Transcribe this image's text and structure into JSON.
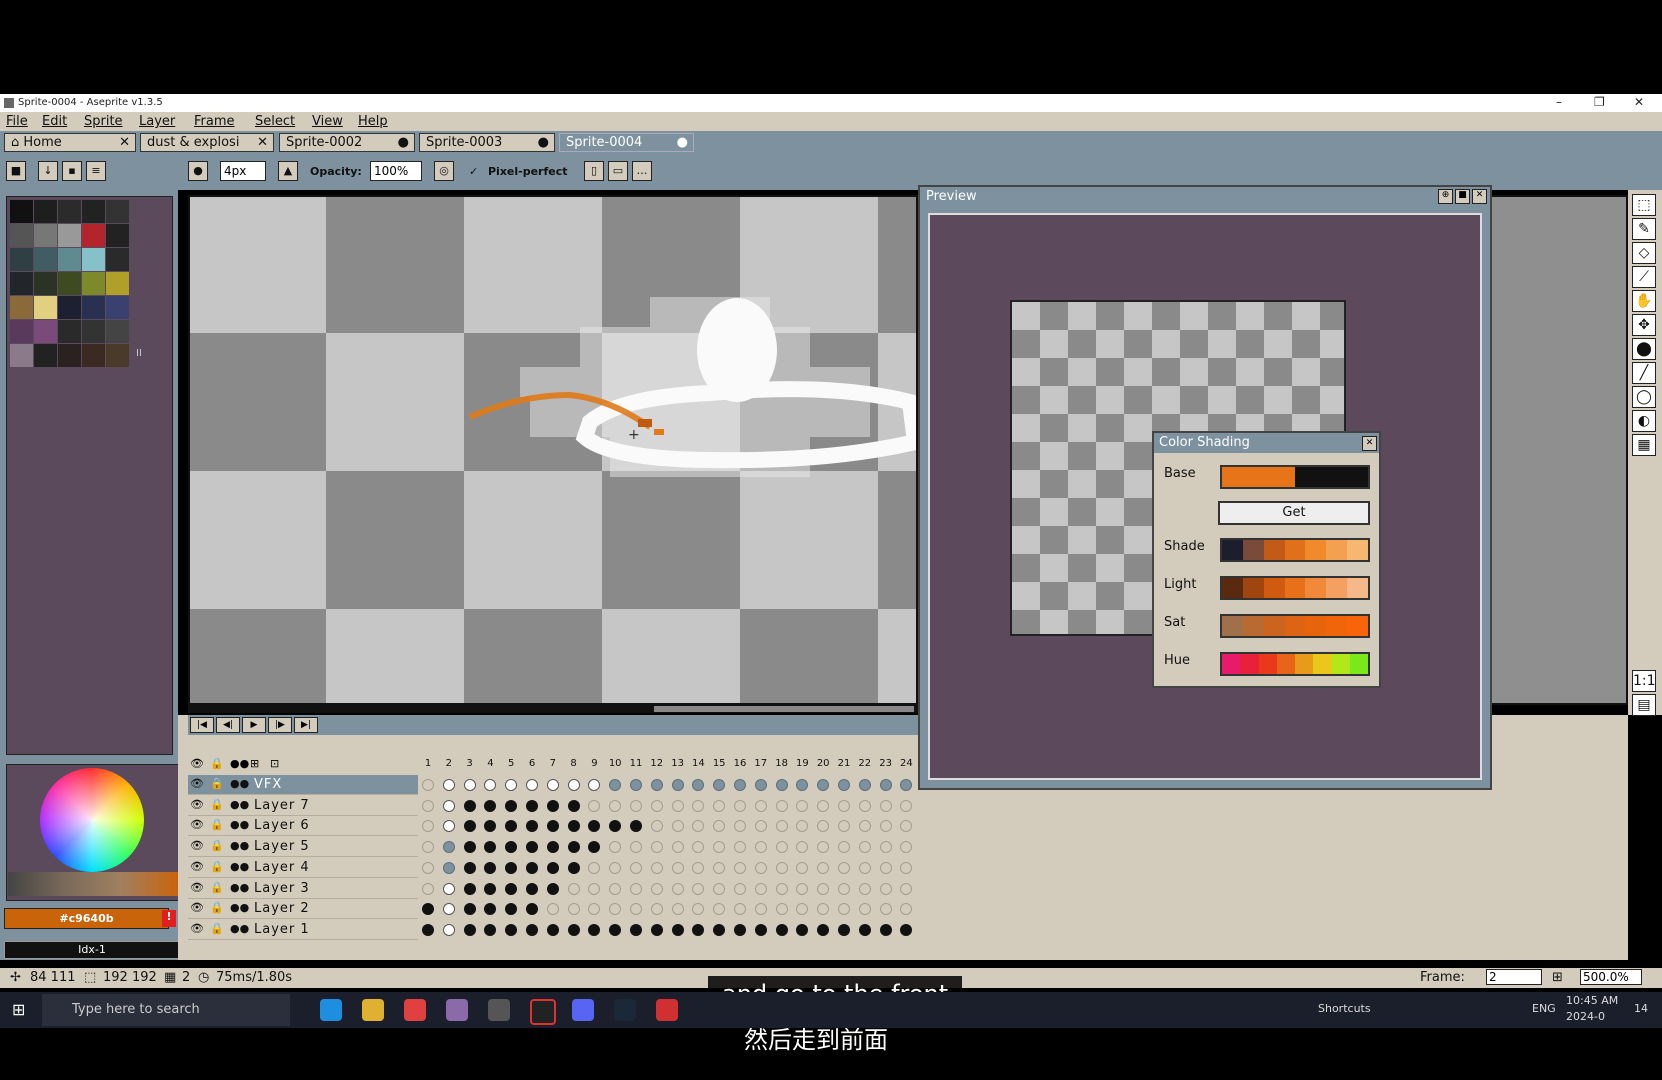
{
  "window": {
    "title": "Sprite-0004 - Aseprite v1.3.5",
    "minimize": "–",
    "maximize": "❐",
    "close": "✕"
  },
  "menu": [
    "File",
    "Edit",
    "Sprite",
    "Layer",
    "Frame",
    "Select",
    "View",
    "Help"
  ],
  "tabs": [
    {
      "label": "Home",
      "close": "✕"
    },
    {
      "label": "dust & explosi",
      "close": "✕"
    },
    {
      "label": "Sprite-0002",
      "close": "●"
    },
    {
      "label": "Sprite-0003",
      "close": "●"
    },
    {
      "label": "Sprite-0004",
      "close": "●"
    }
  ],
  "toolbar": {
    "brush_size": "4px",
    "opacity_label": "Opacity:",
    "opacity_value": "100%",
    "pixel_perfect_label": "Pixel-perfect",
    "pixel_perfect_check": "✓"
  },
  "palette": {
    "colors": [
      "#111111",
      "#1e1e1e",
      "#2b2b2b",
      "#222222",
      "#333333",
      "#555555",
      "#777777",
      "#999999",
      "#b3242c",
      "#222222",
      "#2f3f44",
      "#3f5d63",
      "#5e8a90",
      "#86c0c8",
      "#2a2a2a",
      "#22252a",
      "#2d3324",
      "#3e4a22",
      "#7c8a2a",
      "#b0a02a",
      "#8a6a3a",
      "#e0d080",
      "#1c2030",
      "#2a3050",
      "#3a4070",
      "#5a3a5c",
      "#7a4a7a",
      "#2a2a2a",
      "#333333",
      "#444444",
      "#8a7a8a",
      "#222222",
      "#2a2220",
      "#3a2a22",
      "#4a3a2a"
    ],
    "more": "II"
  },
  "colorbar": {
    "fg_hex": "#c9640b",
    "warning": "!",
    "index": "Idx-1"
  },
  "timeline": {
    "controls": [
      "|◀",
      "◀|",
      "▶",
      "|▶",
      "▶|"
    ],
    "header_icons": [
      "👁",
      "🔒",
      "●●",
      "⊞",
      "⊡"
    ],
    "frames": [
      "1",
      "2",
      "3",
      "4",
      "5",
      "6",
      "7",
      "8",
      "9",
      "10",
      "11",
      "12",
      "13",
      "14",
      "15",
      "16",
      "17",
      "18",
      "19",
      "20",
      "21",
      "22",
      "23",
      "24"
    ],
    "layers": [
      {
        "name": "VFX",
        "cells": "eWWWWWWWWbbbbbbbbbbbbbbb",
        "selected": true
      },
      {
        "name": "Layer 7",
        "cells": "eWFFFFFFeeeeeeeeeeeeeeee",
        "selected": false
      },
      {
        "name": "Layer 6",
        "cells": "eWFFFFFFFFFeeeeeeeeeeeee",
        "selected": false
      },
      {
        "name": "Layer 5",
        "cells": "ebFFFFFFFeeeeeeeeeeeeeee",
        "selected": false
      },
      {
        "name": "Layer 4",
        "cells": "ebFFFFFFeeeeeeeeeeeeeeee",
        "selected": false
      },
      {
        "name": "Layer 3",
        "cells": "eWFFFFFeeeeeeeeeeeeeeeee",
        "selected": false
      },
      {
        "name": "Layer 2",
        "cells": "FWFFFFeeeeeeeeeeeeeeeeee",
        "selected": false
      },
      {
        "name": "Layer 1",
        "cells": "FWFFFFFFFFFFFFFFFFFFFFFF",
        "selected": false
      }
    ]
  },
  "preview": {
    "title": "Preview"
  },
  "shading": {
    "title": "Color Shading",
    "base_label": "Base",
    "get_label": "Get",
    "shade_label": "Shade",
    "light_label": "Light",
    "sat_label": "Sat",
    "hue_label": "Hue",
    "base": [
      "#e8741a",
      "#e8741a",
      "#e8741a",
      "#e8741a",
      "#111111",
      "#111111",
      "#111111",
      "#111111"
    ],
    "shade": [
      "#1c1e2e",
      "#7a4a3a",
      "#c45a18",
      "#e0701a",
      "#f08a2a",
      "#f3a050",
      "#f6b870"
    ],
    "light": [
      "#5a2a10",
      "#a04410",
      "#d05a10",
      "#e8701a",
      "#f08a3a",
      "#f4a060",
      "#f6b888"
    ],
    "sat": [
      "#a0704a",
      "#b86a32",
      "#cc6420",
      "#dc6414",
      "#e8640c",
      "#f0640a",
      "#f8640a"
    ],
    "hue": [
      "#e81a6a",
      "#e8203a",
      "#e83a1a",
      "#e8641a",
      "#e89a1a",
      "#e8c81a",
      "#b0e81a",
      "#7ae81a"
    ]
  },
  "status": {
    "pos": "84 111",
    "size": "192 192",
    "frame_idx": "2",
    "duration": "75ms/1.80s",
    "frame_label": "Frame:",
    "frame_value": "2",
    "zoom": "500.0%"
  },
  "subtitles": {
    "en": "and go to the front",
    "zh": "然后走到前面"
  },
  "taskbar": {
    "search": "Type here to search",
    "shortcuts": "Shortcuts",
    "lang": "ENG",
    "time": "10:45 AM",
    "date": "2024-0",
    "notif": "14"
  }
}
